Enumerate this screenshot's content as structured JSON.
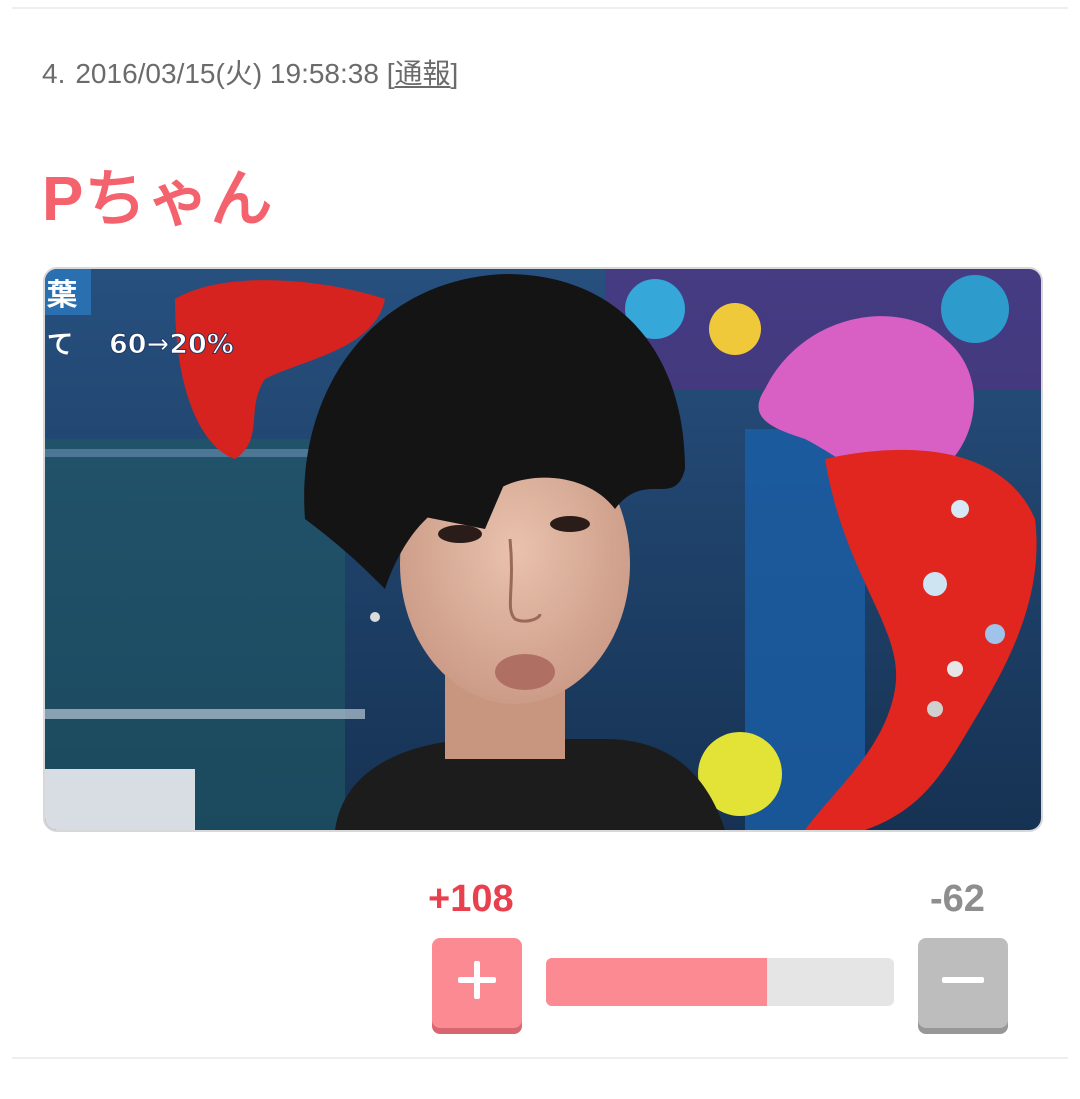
{
  "comment": {
    "number": "4.",
    "datetime": "2016/03/15(火) 19:58:38",
    "report_prefix": "[",
    "report_label": "通報",
    "report_suffix": "]",
    "title": "Pちゃん",
    "image": {
      "overlay_kanji": "葉",
      "overlay_prefix": "て",
      "overlay_text": "60→20%"
    },
    "votes": {
      "plus_label": "+108",
      "minus_label": "-62",
      "plus_count": 108,
      "minus_count": -62,
      "plus_ratio": 0.635
    }
  },
  "colors": {
    "title": "#f4626e",
    "plus": "#e8404f",
    "plus_button": "#fb8a92",
    "minus_button": "#bdbdbd",
    "bar_track": "#e5e5e5"
  },
  "icons": {
    "plus": "plus-icon",
    "minus": "minus-icon"
  }
}
